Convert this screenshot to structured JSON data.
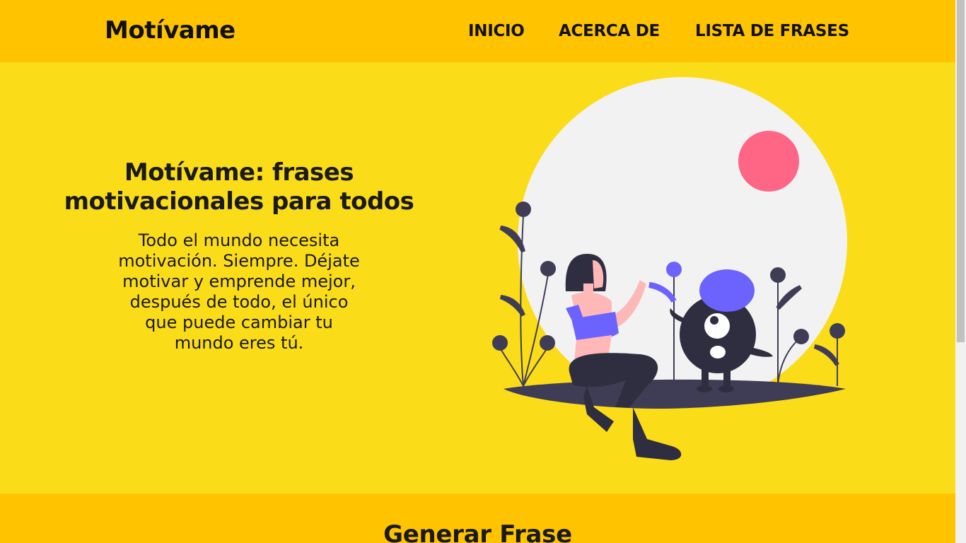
{
  "header": {
    "brand": "Motívame",
    "nav": [
      "INICIO",
      "ACERCA DE",
      "LISTA DE FRASES"
    ]
  },
  "hero": {
    "title": "Motívame: frases motivacionales para todos",
    "text": "Todo el mundo necesita motivación. Siempre. Déjate motivar y emprende mejor, después de todo, el único que puede cambiar tu mundo eres tú.",
    "illustration": "woman-high-five-monster-illustration"
  },
  "section2": {
    "title": "Generar Frase"
  },
  "colors": {
    "header_bg": "#ffc300",
    "hero_bg": "#fbdc19",
    "accent_purple": "#6c63ff",
    "accent_pink": "#ff6584",
    "dark": "#2f2e41",
    "circle": "#f2f2f2"
  }
}
